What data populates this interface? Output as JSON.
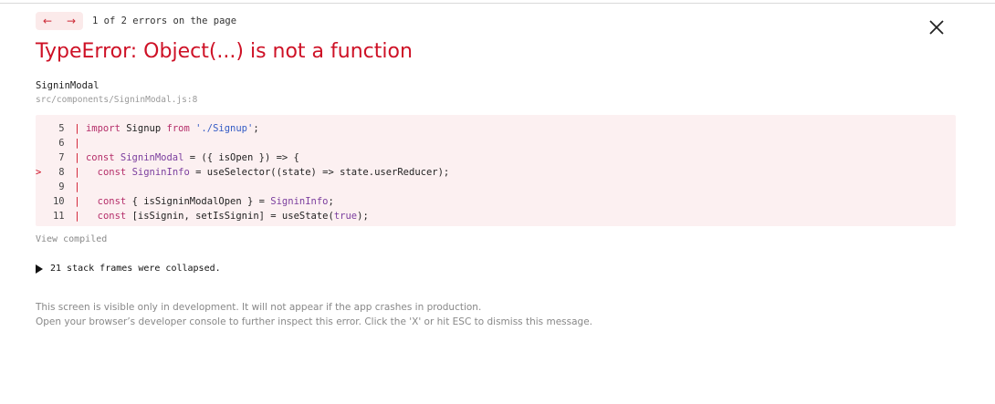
{
  "navigation": {
    "prev_label": "←",
    "next_label": "→",
    "count_text": "1 of 2 errors on the page"
  },
  "error": {
    "title": "TypeError: Object(...) is not a function",
    "component": "SigninModal",
    "location": "src/components/SigninModal.js:8"
  },
  "code": {
    "lines": [
      {
        "marker": " ",
        "number": "5",
        "tokens": [
          {
            "t": "kw",
            "v": "import "
          },
          {
            "t": "plain",
            "v": "Signup "
          },
          {
            "t": "kw",
            "v": "from "
          },
          {
            "t": "str",
            "v": "'./Signup'"
          },
          {
            "t": "plain",
            "v": ";"
          }
        ]
      },
      {
        "marker": " ",
        "number": "6",
        "tokens": []
      },
      {
        "marker": " ",
        "number": "7",
        "tokens": [
          {
            "t": "kw",
            "v": "const "
          },
          {
            "t": "fn",
            "v": "SigninModal"
          },
          {
            "t": "plain",
            "v": " = ({ isOpen }) => {"
          }
        ]
      },
      {
        "marker": ">",
        "number": "8",
        "tokens": [
          {
            "t": "plain",
            "v": "  "
          },
          {
            "t": "kw",
            "v": "const "
          },
          {
            "t": "fn",
            "v": "SigninInfo"
          },
          {
            "t": "plain",
            "v": " = useSelector((state) => state.userReducer);"
          }
        ]
      },
      {
        "marker": " ",
        "number": "9",
        "tokens": []
      },
      {
        "marker": " ",
        "number": "10",
        "tokens": [
          {
            "t": "plain",
            "v": "  "
          },
          {
            "t": "kw",
            "v": "const "
          },
          {
            "t": "plain",
            "v": "{ isSigninModalOpen } = "
          },
          {
            "t": "fn",
            "v": "SigninInfo"
          },
          {
            "t": "plain",
            "v": ";"
          }
        ]
      },
      {
        "marker": " ",
        "number": "11",
        "tokens": [
          {
            "t": "plain",
            "v": "  "
          },
          {
            "t": "kw",
            "v": "const "
          },
          {
            "t": "plain",
            "v": "[isSignin, setIsSignin] = useState("
          },
          {
            "t": "fn",
            "v": "true"
          },
          {
            "t": "plain",
            "v": ");"
          }
        ]
      }
    ]
  },
  "view_compiled_label": "View compiled",
  "stack_frames_label": "21 stack frames were collapsed.",
  "footer": {
    "line1": "This screen is visible only in development. It will not appear if the app crashes in production.",
    "line2": "Open your browser’s developer console to further inspect this error.  Click the 'X' or hit ESC to dismiss this message."
  },
  "icons": {
    "close": "close-icon",
    "expand": "triangle-right-icon"
  },
  "colors": {
    "accent": "#ce1126",
    "code_background": "#fcf0f1",
    "nav_background": "#fbeaea"
  }
}
